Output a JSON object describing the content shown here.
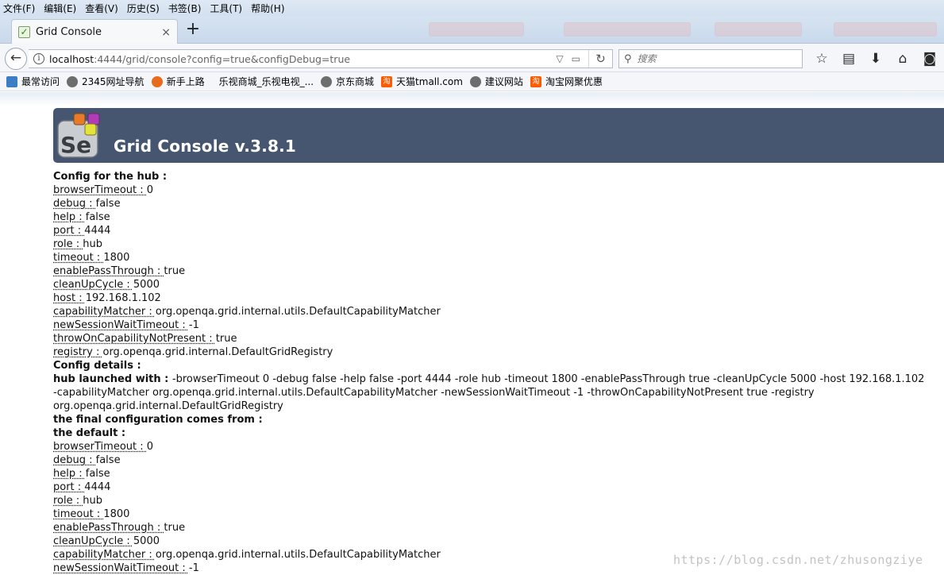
{
  "menubar": {
    "items": [
      "文件(F)",
      "编辑(E)",
      "查看(V)",
      "历史(S)",
      "书签(B)",
      "工具(T)",
      "帮助(H)"
    ]
  },
  "tab": {
    "title": "Grid Console",
    "close_glyph": "×",
    "new_tab_glyph": "+"
  },
  "navbar": {
    "back_glyph": "←",
    "url_host": "localhost",
    "url_rest": ":4444/grid/console?config=true&configDebug=true",
    "search_placeholder": "搜索"
  },
  "bookmarks": [
    {
      "label": "最常访问",
      "icon": "folder-icon"
    },
    {
      "label": "2345网址导航",
      "icon": "globe-icon"
    },
    {
      "label": "新手上路",
      "icon": "firefox-icon"
    },
    {
      "label": "乐视商城_乐视电视_...",
      "icon": "none"
    },
    {
      "label": "京东商城",
      "icon": "globe-icon"
    },
    {
      "label": "天猫tmall.com",
      "icon": "taobao-icon"
    },
    {
      "label": "建议网站",
      "icon": "globe-icon"
    },
    {
      "label": "淘宝网聚优惠",
      "icon": "taobao-icon"
    }
  ],
  "header": {
    "title": "Grid Console v.3.8.1",
    "logo_text": "Se"
  },
  "content": {
    "hub_config_heading": "Config for the hub :",
    "hub_config": [
      {
        "key": "browserTimeout : ",
        "value": "0"
      },
      {
        "key": "debug : ",
        "value": "false"
      },
      {
        "key": "help : ",
        "value": "false"
      },
      {
        "key": "port : ",
        "value": "4444"
      },
      {
        "key": "role : ",
        "value": "hub"
      },
      {
        "key": "timeout : ",
        "value": "1800"
      },
      {
        "key": "enablePassThrough : ",
        "value": "true"
      },
      {
        "key": "cleanUpCycle : ",
        "value": "5000"
      },
      {
        "key": "host : ",
        "value": "192.168.1.102"
      },
      {
        "key": "capabilityMatcher : ",
        "value": "org.openqa.grid.internal.utils.DefaultCapabilityMatcher"
      },
      {
        "key": "newSessionWaitTimeout : ",
        "value": "-1"
      },
      {
        "key": "throwOnCapabilityNotPresent : ",
        "value": "true"
      },
      {
        "key": "registry : ",
        "value": "org.openqa.grid.internal.DefaultGridRegistry"
      }
    ],
    "details_heading": "Config details :",
    "launched_label": "hub launched with : ",
    "launched_line1": "-browserTimeout 0 -debug false -help false -port 4444 -role hub -timeout 1800 -enablePassThrough true -cleanUpCycle 5000 -host 192.168.1.102",
    "launched_line2": "-capabilityMatcher org.openqa.grid.internal.utils.DefaultCapabilityMatcher -newSessionWaitTimeout -1 -throwOnCapabilityNotPresent true -registry",
    "launched_line3": "org.openqa.grid.internal.DefaultGridRegistry",
    "final_heading": "the final configuration comes from :",
    "default_heading": "the default :",
    "default_config": [
      {
        "key": "browserTimeout : ",
        "value": "0"
      },
      {
        "key": "debug : ",
        "value": "false"
      },
      {
        "key": "help : ",
        "value": "false"
      },
      {
        "key": "port : ",
        "value": "4444"
      },
      {
        "key": "role : ",
        "value": "hub"
      },
      {
        "key": "timeout : ",
        "value": "1800"
      },
      {
        "key": "enablePassThrough : ",
        "value": "true"
      },
      {
        "key": "cleanUpCycle : ",
        "value": "5000"
      },
      {
        "key": "capabilityMatcher : ",
        "value": "org.openqa.grid.internal.utils.DefaultCapabilityMatcher"
      },
      {
        "key": "newSessionWaitTimeout : ",
        "value": "-1"
      }
    ]
  },
  "watermark": "https://blog.csdn.net/zhusongziye"
}
